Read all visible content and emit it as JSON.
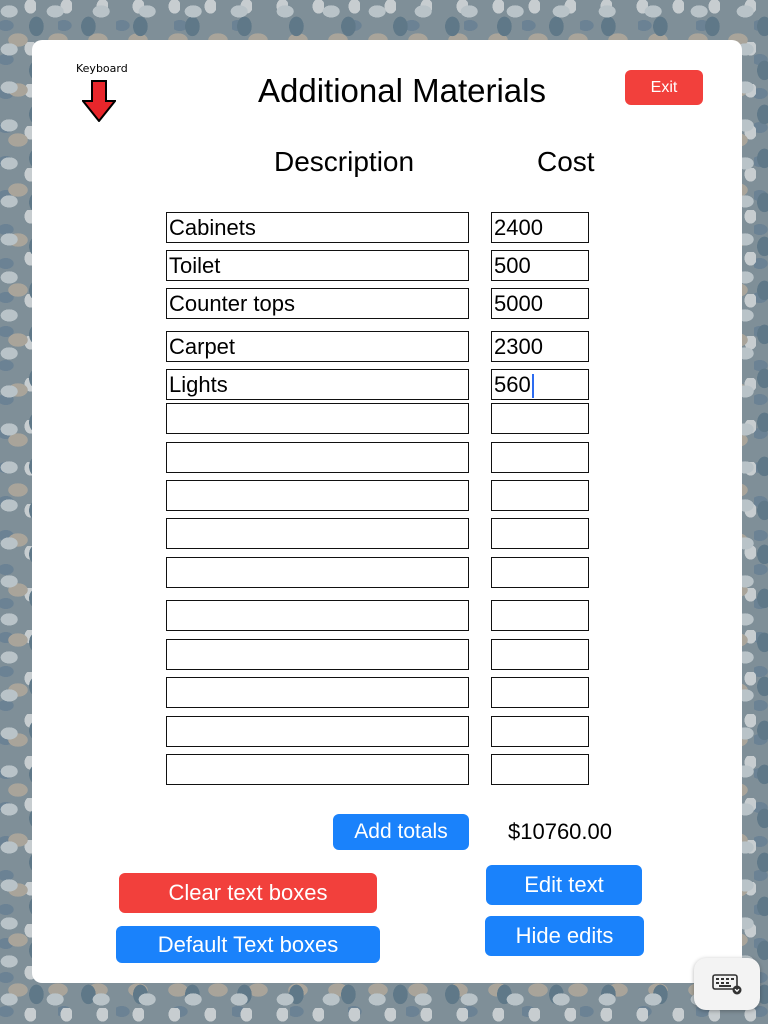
{
  "screen": {
    "keyboard_label": "Keyboard",
    "title": "Additional Materials",
    "exit_label": "Exit"
  },
  "columns": {
    "description": "Description",
    "cost": "Cost"
  },
  "rows": [
    {
      "description": "Cabinets",
      "cost": "2400"
    },
    {
      "description": "Toilet",
      "cost": "500"
    },
    {
      "description": "Counter tops",
      "cost": "5000"
    },
    {
      "description": "Carpet",
      "cost": "2300"
    },
    {
      "description": "Lights",
      "cost": "560"
    },
    {
      "description": "",
      "cost": ""
    },
    {
      "description": "",
      "cost": ""
    },
    {
      "description": "",
      "cost": ""
    },
    {
      "description": "",
      "cost": ""
    },
    {
      "description": "",
      "cost": ""
    },
    {
      "description": "",
      "cost": ""
    },
    {
      "description": "",
      "cost": ""
    },
    {
      "description": "",
      "cost": ""
    },
    {
      "description": "",
      "cost": ""
    },
    {
      "description": "",
      "cost": ""
    }
  ],
  "actions": {
    "add_totals": "Add totals",
    "total_value": "$10760.00",
    "clear_text_boxes": "Clear text boxes",
    "default_text_boxes": "Default Text boxes",
    "edit_text": "Edit text",
    "hide_edits": "Hide edits"
  },
  "icons": {
    "keyboard_arrow": "arrow-down-icon",
    "keyboard_toggle": "keyboard-icon"
  },
  "colors": {
    "primary_blue": "#1a82fb",
    "danger_red": "#f2403c",
    "caret": "#2d6cf0"
  }
}
